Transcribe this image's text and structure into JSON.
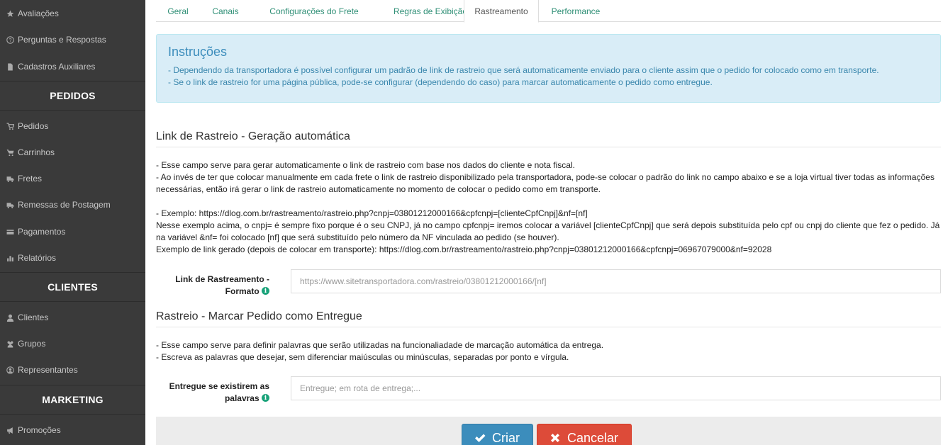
{
  "sidebar": {
    "items_top": [
      {
        "label": "Avaliações",
        "icon": "star-icon"
      },
      {
        "label": "Perguntas e Respostas",
        "icon": "question-circle-icon"
      },
      {
        "label": "Cadastros Auxiliares",
        "icon": "file-icon"
      }
    ],
    "section_pedidos": "PEDIDOS",
    "items_pedidos": [
      {
        "label": "Pedidos",
        "icon": "cart-icon"
      },
      {
        "label": "Carrinhos",
        "icon": "shopping-cart-icon"
      },
      {
        "label": "Fretes",
        "icon": "truck-icon"
      },
      {
        "label": "Remessas de Postagem",
        "icon": "truck-icon"
      },
      {
        "label": "Pagamentos",
        "icon": "credit-card-icon"
      },
      {
        "label": "Relatórios",
        "icon": "bar-chart-icon"
      }
    ],
    "section_clientes": "CLIENTES",
    "items_clientes": [
      {
        "label": "Clientes",
        "icon": "user-icon"
      },
      {
        "label": "Grupos",
        "icon": "users-icon"
      },
      {
        "label": "Representantes",
        "icon": "user-circle-icon"
      }
    ],
    "section_marketing": "MARKETING",
    "items_marketing": [
      {
        "label": "Promoções",
        "icon": "bullhorn-icon"
      }
    ]
  },
  "tabs": [
    {
      "label": "Geral"
    },
    {
      "label": "Canais"
    },
    {
      "label": "Configurações do Frete"
    },
    {
      "label": "Regras de Exibição"
    },
    {
      "label": "Rastreamento",
      "active": true
    },
    {
      "label": "Performance"
    }
  ],
  "instructions": {
    "title": "Instruções",
    "lines": [
      "- Dependendo da transportadora é possível configurar um padrão de link de rastreio que será automaticamente enviado para o cliente assim que o pedido for colocado como em transporte.",
      "- Se o link de rastreio for uma página pública, pode-se configurar (dependendo do caso) para marcar automaticamente o pedido como entregue."
    ]
  },
  "link_section": {
    "title": "Link de Rastreio - Geração automática",
    "lines": [
      "- Esse campo serve para gerar automaticamente o link de rastreio com base nos dados do cliente e nota fiscal.",
      "- Ao invés de ter que colocar manualmente em cada frete o link de rastreio disponibilizado pela transportadora, pode-se colocar o padrão do link no campo abaixo e se a loja virtual tiver todas as informações necessárias, então irá gerar o link de rastreio automaticamente no momento de colocar o pedido como em transporte.",
      "",
      "- Exemplo: https://dlog.com.br/rastreamento/rastreio.php?cnpj=03801212000166&cpfcnpj=[clienteCpfCnpj]&nf=[nf]",
      "Nesse exemplo acima, o cnpj= é sempre fixo porque é o seu CNPJ, já no campo cpfcnpj= iremos colocar a variável [clienteCpfCnpj] que será depois substituída pelo cpf ou cnpj do cliente que fez o pedido. Já na variável &nf= foi colocado [nf] que será substituído pelo número da NF vinculada ao pedido (se houver).",
      "Exemplo de link gerado (depois de colocar em transporte): https://dlog.com.br/rastreamento/rastreio.php?cnpj=03801212000166&cpfcnpj=06967079000&nf=92028"
    ],
    "field_label_1": "Link de Rastreamento -",
    "field_label_2": "Formato",
    "field_placeholder": "https://www.sitetransportadora.com/rastreio/03801212000166/[nf]",
    "field_value": ""
  },
  "delivered_section": {
    "title": "Rastreio - Marcar Pedido como Entregue",
    "lines": [
      "- Esse campo serve para definir palavras que serão utilizadas na funcionaliadade de marcação automática da entrega.",
      "- Escreva as palavras que desejar, sem diferenciar maiúsculas ou minúsculas, separadas por ponto e vírgula."
    ],
    "field_label_1": "Entregue se existirem as",
    "field_label_2": "palavras",
    "field_placeholder": "Entregue; em rota de entrega;...",
    "field_value": ""
  },
  "buttons": {
    "create": "Criar",
    "cancel": "Cancelar"
  }
}
